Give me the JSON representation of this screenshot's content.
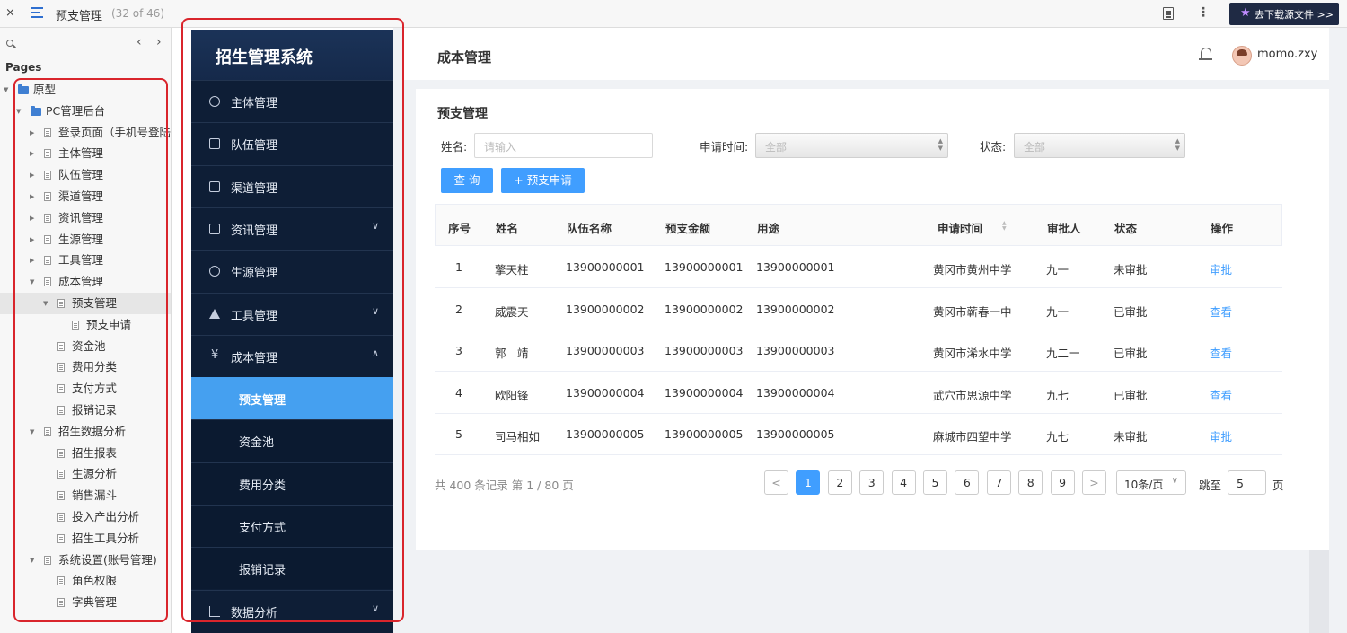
{
  "toolbar": {
    "close_glyph": "×",
    "title": "预支管理",
    "count": "(32 of 46)",
    "download_label": "去下载源文件 >>"
  },
  "pages_panel": {
    "heading": "Pages",
    "prev_glyph": "‹",
    "next_glyph": "›",
    "tree": [
      {
        "label": "原型",
        "type": "folder",
        "level": 0,
        "expanded": true
      },
      {
        "label": "PC管理后台",
        "type": "folder",
        "level": 1,
        "expanded": true
      },
      {
        "label": "登录页面（手机号登陆",
        "type": "page",
        "level": 2,
        "expanded": false
      },
      {
        "label": "主体管理",
        "type": "page",
        "level": 2,
        "expanded": false
      },
      {
        "label": "队伍管理",
        "type": "page",
        "level": 2,
        "expanded": false
      },
      {
        "label": "渠道管理",
        "type": "page",
        "level": 2,
        "expanded": false
      },
      {
        "label": "资讯管理",
        "type": "page",
        "level": 2,
        "expanded": false
      },
      {
        "label": "生源管理",
        "type": "page",
        "level": 2,
        "expanded": false
      },
      {
        "label": "工具管理",
        "type": "page",
        "level": 2,
        "expanded": false
      },
      {
        "label": "成本管理",
        "type": "page",
        "level": 2,
        "expanded": true
      },
      {
        "label": "预支管理",
        "type": "page",
        "level": 3,
        "expanded": true,
        "selected": true
      },
      {
        "label": "预支申请",
        "type": "page",
        "level": 4
      },
      {
        "label": "资金池",
        "type": "page",
        "level": 3
      },
      {
        "label": "费用分类",
        "type": "page",
        "level": 3
      },
      {
        "label": "支付方式",
        "type": "page",
        "level": 3
      },
      {
        "label": "报销记录",
        "type": "page",
        "level": 3
      },
      {
        "label": "招生数据分析",
        "type": "page",
        "level": 2,
        "expanded": true
      },
      {
        "label": "招生报表",
        "type": "page",
        "level": 3
      },
      {
        "label": "生源分析",
        "type": "page",
        "level": 3
      },
      {
        "label": "销售漏斗",
        "type": "page",
        "level": 3
      },
      {
        "label": "投入产出分析",
        "type": "page",
        "level": 3
      },
      {
        "label": "招生工具分析",
        "type": "page",
        "level": 3
      },
      {
        "label": "系统设置(账号管理)",
        "type": "page",
        "level": 2,
        "expanded": true
      },
      {
        "label": "角色权限",
        "type": "page",
        "level": 3
      },
      {
        "label": "字典管理",
        "type": "page",
        "level": 3
      }
    ]
  },
  "sidebar": {
    "brand": "招生管理系统",
    "items": [
      {
        "label": "主体管理",
        "icon": "gauge-icon"
      },
      {
        "label": "队伍管理",
        "icon": "edit-icon"
      },
      {
        "label": "渠道管理",
        "icon": "table-icon"
      },
      {
        "label": "资讯管理",
        "icon": "document-icon",
        "chevron": "∨"
      },
      {
        "label": "生源管理",
        "icon": "check-circle-icon"
      },
      {
        "label": "工具管理",
        "icon": "warning-icon",
        "chevron": "∨"
      },
      {
        "label": "成本管理",
        "icon": "yen-icon",
        "chevron": "∧"
      },
      {
        "label": "预支管理",
        "sub": true,
        "active": true
      },
      {
        "label": "资金池",
        "sub": true
      },
      {
        "label": "费用分类",
        "sub": true
      },
      {
        "label": "支付方式",
        "sub": true
      },
      {
        "label": "报销记录",
        "sub": true
      },
      {
        "label": "数据分析",
        "icon": "bar-chart-icon",
        "chevron": "∨"
      }
    ]
  },
  "header": {
    "title": "成本管理",
    "username": "momo.zxy"
  },
  "content": {
    "section_title": "预支管理",
    "filters": {
      "name_label": "姓名:",
      "name_placeholder": "请输入",
      "date_label": "申请时间:",
      "date_value": "全部",
      "status_label": "状态:",
      "status_value": "全部"
    },
    "buttons": {
      "query": "查 询",
      "apply": "+ 预支申请"
    },
    "table": {
      "headers": [
        "序号",
        "姓名",
        "队伍名称",
        "预支金额",
        "用途",
        "申请时间",
        "审批人",
        "状态",
        "操作"
      ],
      "rows": [
        [
          "1",
          "擎天柱",
          "13900000001",
          "13900000001",
          "13900000001",
          "黄冈市黄州中学",
          "九一",
          "未审批",
          "审批"
        ],
        [
          "2",
          "威震天",
          "13900000002",
          "13900000002",
          "13900000002",
          "黄冈市蕲春一中",
          "九一",
          "已审批",
          "查看"
        ],
        [
          "3",
          "郭　靖",
          "13900000003",
          "13900000003",
          "13900000003",
          "黄冈市浠水中学",
          "九二一",
          "已审批",
          "查看"
        ],
        [
          "4",
          "欧阳锋",
          "13900000004",
          "13900000004",
          "13900000004",
          "武穴市思源中学",
          "九七",
          "已审批",
          "查看"
        ],
        [
          "5",
          "司马相如",
          "13900000005",
          "13900000005",
          "13900000005",
          "麻城市四望中学",
          "九七",
          "未审批",
          "审批"
        ]
      ]
    },
    "pagination": {
      "total_text": "共 400 条记录 第 1 / 80 页",
      "prev": "<",
      "next": ">",
      "pages": [
        "1",
        "2",
        "3",
        "4",
        "5",
        "6",
        "7",
        "8",
        "9"
      ],
      "current": "1",
      "page_size": "10条/页",
      "jump_label": "跳至",
      "jump_value": "5",
      "jump_suffix": "页"
    }
  },
  "colors": {
    "accent": "#409eff",
    "sidebar_bg": "#0e1e36",
    "annotation": "#d9252c"
  }
}
